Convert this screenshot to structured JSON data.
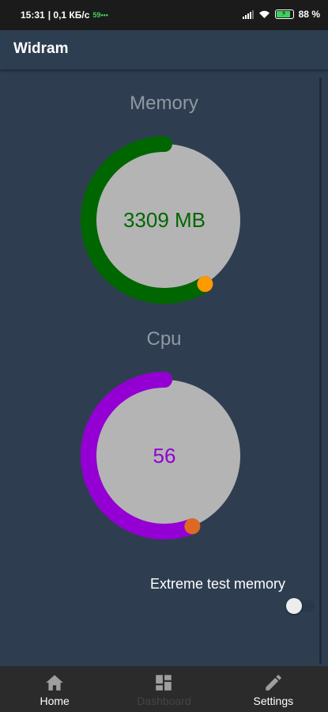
{
  "status_bar": {
    "time": "15:31",
    "network_speed": "| 0,1 КБ/с",
    "extra": "59•••",
    "battery": "88"
  },
  "app": {
    "title": "Widram"
  },
  "memory": {
    "title": "Memory",
    "value_text": "3309 MB",
    "progress": 0.59,
    "color": "#006600",
    "knob_color": "#ff9900"
  },
  "cpu": {
    "title": "Cpu",
    "value_text": "56",
    "progress": 0.56,
    "color": "#9400d3",
    "knob_color": "#dd6a22"
  },
  "extreme": {
    "label": "Extreme test memory",
    "enabled": false
  },
  "nav": {
    "items": [
      {
        "label": "Home",
        "icon": "home-icon",
        "active": false
      },
      {
        "label": "Dashboard",
        "icon": "dashboard-icon",
        "active": true
      },
      {
        "label": "Settings",
        "icon": "pencil-icon",
        "active": false
      }
    ]
  }
}
